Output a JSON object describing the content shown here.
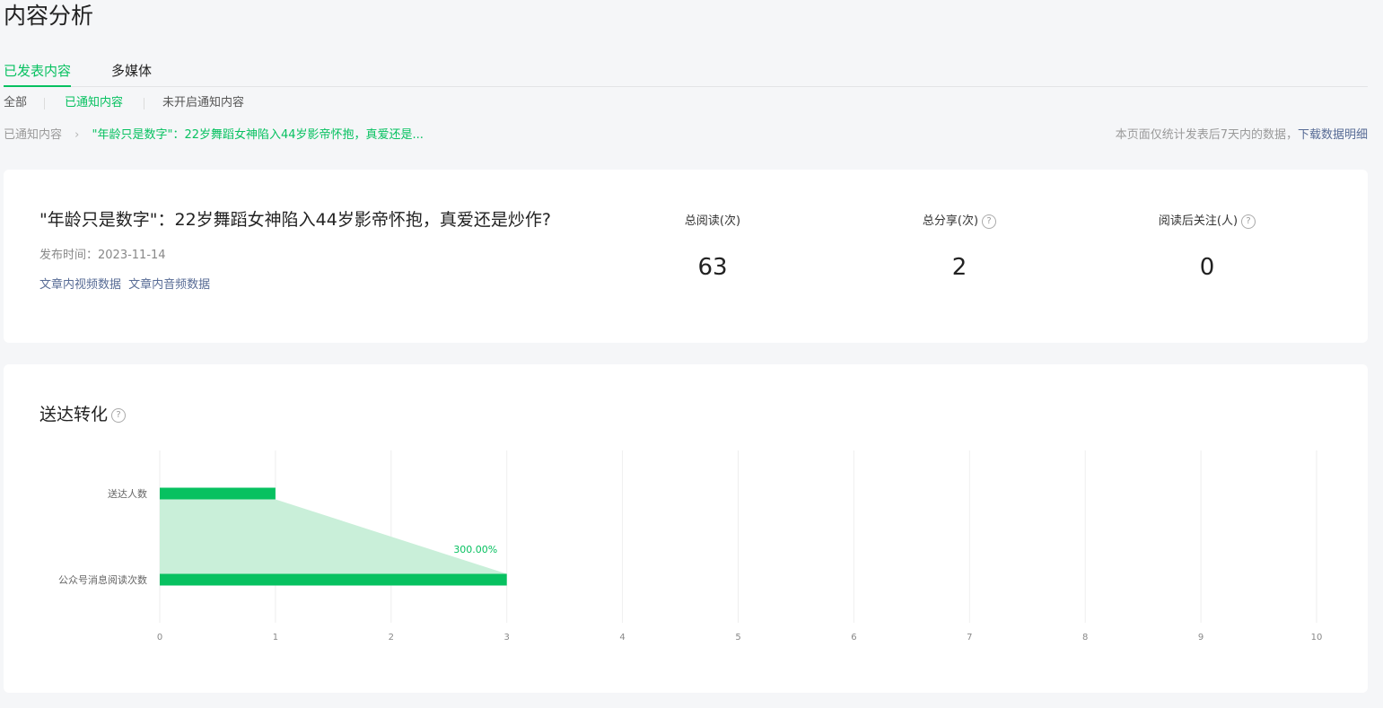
{
  "page": {
    "title": "内容分析"
  },
  "tabs": {
    "items": [
      "已发表内容",
      "多媒体"
    ],
    "active": 0
  },
  "subtabs": {
    "items": [
      "全部",
      "已通知内容",
      "未开启通知内容"
    ],
    "active": 1
  },
  "breadcrumb": {
    "parent": "已通知内容",
    "current": "\"年龄只是数字\"：22岁舞蹈女神陷入44岁影帝怀抱，真爱还是..."
  },
  "notice": {
    "text": "本页面仅统计发表后7天内的数据，",
    "link": "下载数据明细"
  },
  "article": {
    "title": "\"年龄只是数字\"：22岁舞蹈女神陷入44岁影帝怀抱，真爱还是炒作?",
    "publish_time": "发布时间：2023-11-14",
    "links": [
      "文章内视频数据",
      "文章内音频数据"
    ]
  },
  "stats": [
    {
      "label": "总阅读(次)",
      "value": "63",
      "help": false
    },
    {
      "label": "总分享(次)",
      "value": "2",
      "help": true
    },
    {
      "label": "阅读后关注(人)",
      "value": "0",
      "help": true
    }
  ],
  "conversion": {
    "title": "送达转化"
  },
  "chart_data": {
    "type": "bar",
    "orientation": "horizontal",
    "categories": [
      "送达人数",
      "公众号消息阅读次数"
    ],
    "values": [
      1,
      3
    ],
    "xlim": [
      0,
      10
    ],
    "xticks": [
      0,
      1,
      2,
      3,
      4,
      5,
      6,
      7,
      8,
      9,
      10
    ],
    "conversion_label": "300.00%",
    "grid": true,
    "colors": {
      "bar": "#07c160",
      "area": "#c9efd9",
      "grid": "#eeeeee"
    }
  },
  "colors": {
    "accent": "#07c160",
    "link": "#576b95"
  }
}
